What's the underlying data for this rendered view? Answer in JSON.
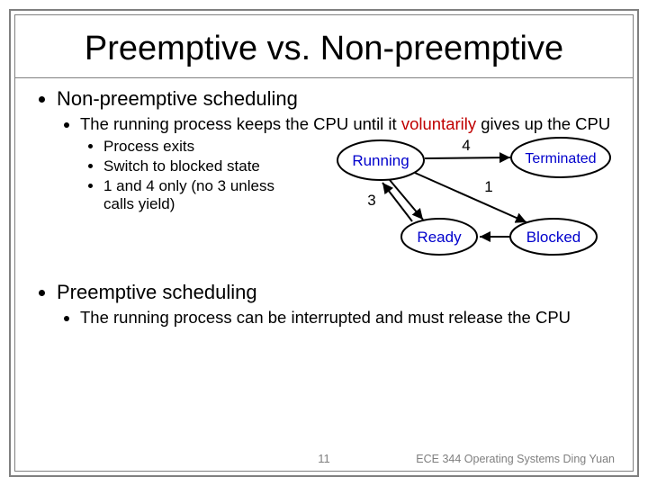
{
  "title": "Preemptive vs. Non-preemptive",
  "section1": {
    "heading": "Non-preemptive scheduling",
    "line_pre": "The running process keeps the CPU until it ",
    "line_red": "voluntarily",
    "line_post": " gives up the CPU",
    "items": [
      "Process exits",
      "Switch to blocked state",
      "1 and 4 only (no 3 unless calls yield)"
    ]
  },
  "diagram": {
    "states": [
      "Running",
      "Terminated",
      "Ready",
      "Blocked"
    ],
    "edges": {
      "running_terminated": "4",
      "running_blocked": "1",
      "running_ready": "3"
    }
  },
  "section2": {
    "heading": "Preemptive scheduling",
    "line": "The running process can be interrupted and must release the CPU"
  },
  "slide_number": "11",
  "course": "ECE 344 Operating Systems Ding Yuan"
}
